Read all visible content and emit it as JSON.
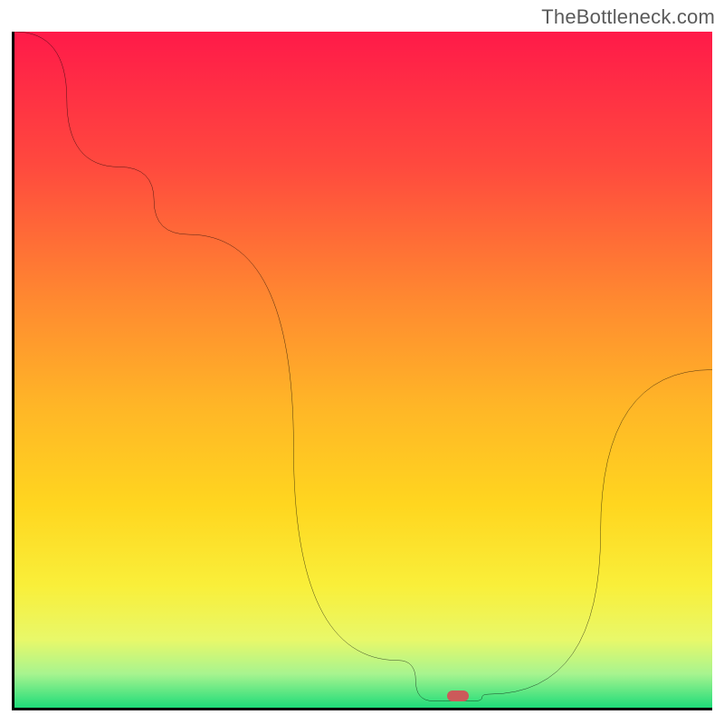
{
  "watermark": "TheBottleneck.com",
  "marker": {
    "x_pct": 63.5,
    "y_pct": 98.3
  },
  "colors": {
    "axis": "#000000",
    "line": "#000000",
    "marker": "#cc5a5a",
    "gradient_stops": [
      {
        "offset": "0%",
        "color": "#ff1a49"
      },
      {
        "offset": "20%",
        "color": "#ff4a3e"
      },
      {
        "offset": "40%",
        "color": "#ff8a30"
      },
      {
        "offset": "55%",
        "color": "#ffb527"
      },
      {
        "offset": "70%",
        "color": "#ffd61f"
      },
      {
        "offset": "82%",
        "color": "#f9ef3a"
      },
      {
        "offset": "90%",
        "color": "#e8f86a"
      },
      {
        "offset": "95%",
        "color": "#a7f48f"
      },
      {
        "offset": "100%",
        "color": "#1edc79"
      }
    ]
  },
  "chart_data": {
    "type": "line",
    "title": "",
    "xlabel": "",
    "ylabel": "",
    "xlim": [
      0,
      100
    ],
    "ylim": [
      0,
      100
    ],
    "x": [
      0,
      15,
      25,
      55,
      60,
      66,
      68,
      100
    ],
    "values": [
      100,
      80,
      70,
      7,
      1,
      1,
      2,
      50
    ],
    "note": "Values are read as percentages of the vertical axis, visually estimated; the curve drops from top-left, has a flat minimum near x≈60–66 at y≈1, then rises to about y≈50 at the right edge."
  }
}
